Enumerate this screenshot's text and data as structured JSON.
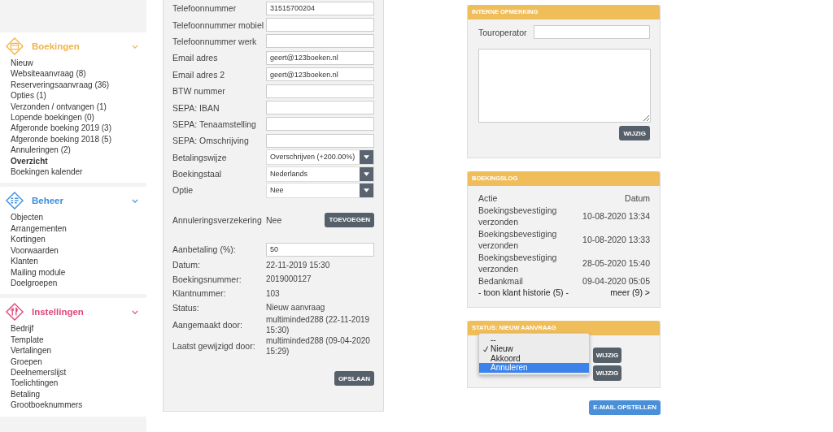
{
  "sidebar": {
    "sections": [
      {
        "title": "Boekingen",
        "kind": "window",
        "color": "#f0b44c",
        "expanded": true,
        "items": [
          {
            "label": "Nieuw",
            "selected": false
          },
          {
            "label": "Websiteaanvraag (8)",
            "selected": false
          },
          {
            "label": "Reserveringsaanvraag (36)",
            "selected": false
          },
          {
            "label": "Opties (1)",
            "selected": false
          },
          {
            "label": "Verzonden / ontvangen (1)",
            "selected": false
          },
          {
            "label": "Lopende boekingen (0)",
            "selected": false
          },
          {
            "label": "Afgeronde boeking 2019 (3)",
            "selected": false
          },
          {
            "label": "Afgeronde boeking 2018 (5)",
            "selected": false
          },
          {
            "label": "Annuleringen (2)",
            "selected": false
          },
          {
            "label": "Overzicht",
            "selected": true
          },
          {
            "label": "Boekingen kalender",
            "selected": false
          }
        ]
      },
      {
        "title": "Beheer",
        "kind": "list",
        "color": "#3c8ddc",
        "expanded": true,
        "items": [
          {
            "label": "Objecten",
            "selected": false
          },
          {
            "label": "Arrangementen",
            "selected": false
          },
          {
            "label": "Kortingen",
            "selected": false
          },
          {
            "label": "Voorwaarden",
            "selected": false
          },
          {
            "label": "Klanten",
            "selected": false
          },
          {
            "label": "Mailing module",
            "selected": false
          },
          {
            "label": "Doelgroepen",
            "selected": false
          }
        ]
      },
      {
        "title": "Instellingen",
        "kind": "cutlery",
        "color": "#e0457b",
        "expanded": true,
        "items": [
          {
            "label": "Bedrijf",
            "selected": false
          },
          {
            "label": "Template",
            "selected": false
          },
          {
            "label": "Vertalingen",
            "selected": false
          },
          {
            "label": "Groepen",
            "selected": false
          },
          {
            "label": "Deelnemerslijst",
            "selected": false
          },
          {
            "label": "Toelichtingen",
            "selected": false
          },
          {
            "label": "Betaling",
            "selected": false
          },
          {
            "label": "Grootboeknummers",
            "selected": false
          }
        ]
      }
    ]
  },
  "form": {
    "fields": [
      {
        "label": "Telefoonnummer",
        "kind": "input",
        "value": "31515700204"
      },
      {
        "label": "Telefoonnummer mobiel",
        "kind": "input"
      },
      {
        "label": "Telefoonnummer werk",
        "kind": "input"
      },
      {
        "label": "Email adres",
        "kind": "input",
        "value": "geert@123boeken.nl"
      },
      {
        "label": "Email adres 2",
        "kind": "input",
        "value": "geert@123boeken.nl"
      },
      {
        "label": "BTW nummer",
        "kind": "input"
      },
      {
        "label": "SEPA: IBAN",
        "kind": "input"
      },
      {
        "label": "SEPA: Tenaamstelling",
        "kind": "input"
      },
      {
        "label": "SEPA: Omschrijving",
        "kind": "input"
      },
      {
        "label": "Betalingswijze",
        "kind": "select",
        "value": "Overschrijven (+200.00%)"
      },
      {
        "label": "Boekingstaal",
        "kind": "select",
        "value": "Nederlands"
      },
      {
        "label": "Optie",
        "kind": "select",
        "value": "Nee"
      }
    ],
    "insurance": {
      "label": "Annuleringsverzekering",
      "value": "Nee",
      "button": "TOEVOEGEN"
    },
    "payment": {
      "label": "Aanbetaling (%):",
      "value": "50"
    },
    "info": [
      {
        "label": "Datum:",
        "value": "22-11-2019 15:30"
      },
      {
        "label": "Boekingsnummer:",
        "value": "2019000127"
      },
      {
        "label": "Klantnummer:",
        "value": "103"
      },
      {
        "label": "Status:",
        "value": "Nieuw aanvraag"
      },
      {
        "label": "Aangemaakt door:",
        "value": "multiminded288 (22-11-2019 15:30)"
      },
      {
        "label": "Laatst gewijzigd door:",
        "value": "multiminded288 (09-04-2020 15:29)"
      }
    ],
    "save_button": "OPSLAAN"
  },
  "internal_note": {
    "title": "INTERNE OPMERKING",
    "touroperator_label": "Touroperator",
    "button": "WIJZIG"
  },
  "booking_log": {
    "title": "BOEKINGSLOG",
    "columns": [
      "Actie",
      "Datum"
    ],
    "rows": [
      {
        "action": "Boekingsbevestiging verzonden",
        "date": "10-08-2020 13:34"
      },
      {
        "action": "Boekingsbevestiging verzonden",
        "date": "10-08-2020 13:33"
      },
      {
        "action": "Boekingsbevestiging verzonden",
        "date": "28-05-2020 15:40"
      },
      {
        "action": "Bedankmail",
        "date": "09-04-2020 05:05"
      }
    ],
    "history_link": "- toon klant historie (5) -",
    "more_link": "meer (9) >"
  },
  "status": {
    "title": "STATUS: NIEUW AANVRAAG",
    "options": [
      {
        "label": "--",
        "checked": false,
        "selected": false
      },
      {
        "label": "Nieuw",
        "checked": true,
        "selected": false
      },
      {
        "label": "Akkoord",
        "checked": false,
        "selected": false
      },
      {
        "label": "Annuleren",
        "checked": false,
        "selected": true
      }
    ],
    "buttons": [
      "WIJZIG",
      "WIJZIG"
    ]
  },
  "email_button": "E-MAIL OPSTELLEN"
}
